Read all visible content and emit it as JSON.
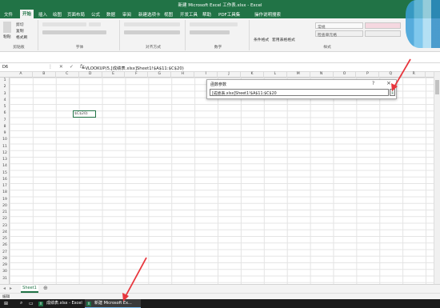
{
  "window": {
    "title": "新建 Microsoft Excel 工作表.xlsx - Excel"
  },
  "ribbon_tabs": [
    "文件",
    "开始",
    "插入",
    "绘图",
    "页面布局",
    "公式",
    "数据",
    "审阅",
    "新建选项卡",
    "视图",
    "开发工具",
    "帮助",
    "PDF工具集",
    "操作说明搜索"
  ],
  "ribbon": {
    "paste": "粘贴",
    "cut": "剪切",
    "copy": "复制",
    "format_painter": "格式刷",
    "group_clipboard": "剪贴板",
    "group_font": "字体",
    "group_align": "对齐方式",
    "group_number": "数字",
    "group_styles": "样式",
    "cond_format": "条件格式",
    "table_format": "套用表格格式",
    "style_normal": "常规",
    "style_check": "检查单元格"
  },
  "formula_bar": {
    "name_box": "D6",
    "formula": "=VLOOKUP(5,[成绩表.xlsx]Sheet1!$A$11:$C$20)"
  },
  "columns": [
    "A",
    "B",
    "C",
    "D",
    "E",
    "F",
    "G",
    "H",
    "I",
    "J",
    "K",
    "L",
    "M",
    "N",
    "O",
    "P",
    "Q",
    "R"
  ],
  "rows": [
    "1",
    "2",
    "3",
    "4",
    "5",
    "6",
    "7",
    "8",
    "9",
    "10",
    "11",
    "12",
    "13",
    "14",
    "15",
    "16",
    "17",
    "18",
    "19",
    "20",
    "21",
    "22",
    "23",
    "24",
    "25",
    "26",
    "27",
    "28",
    "29",
    "30",
    "31"
  ],
  "active_cell_text": "$C$20)",
  "dialog": {
    "title": "函数参数",
    "help": "?",
    "close": "×",
    "input_value": "[成绩表.xlsx]Sheet1!$A$11:$C$20",
    "collapse_icon": "expand-icon"
  },
  "sheets": [
    "Sheet1"
  ],
  "status": "编辑",
  "taskbar": [
    {
      "label": "成绩表.xlsx - Excel",
      "active": false
    },
    {
      "label": "新建 Microsoft Ex...",
      "active": true
    }
  ],
  "colors": {
    "accent": "#217346",
    "arrow": "#e8363d"
  }
}
